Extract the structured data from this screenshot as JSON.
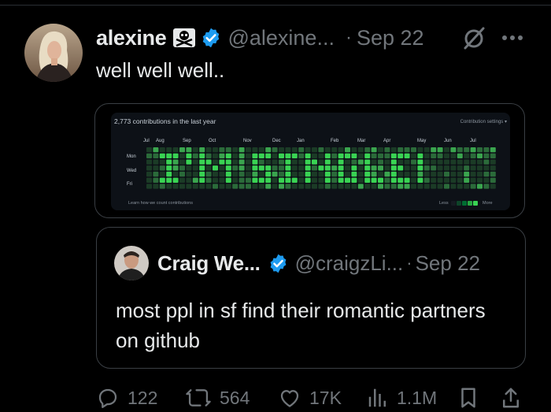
{
  "author": {
    "name": "alexine",
    "handle": "@alexine...",
    "date": "Sep 22"
  },
  "tweet": {
    "text": "well well well.."
  },
  "github_card": {
    "title": "2,773 contributions in the last year",
    "settings": "Contribution settings ▾",
    "months": [
      "Jul",
      "Aug",
      "Sep",
      "Oct",
      "Nov",
      "Dec",
      "Jan",
      "Feb",
      "Mar",
      "Apr",
      "May",
      "Jun",
      "Jul"
    ],
    "days": [
      "Mon",
      "Wed",
      "Fri"
    ],
    "footer": "Learn how we count contributions",
    "legend_less": "Less",
    "legend_more": "More",
    "message": "I'M SINGLE!",
    "colors": {
      "empty": "#1b3b26",
      "light": "#2b6b3a",
      "mid": "#3aa54e",
      "bright": "#39d353"
    }
  },
  "quote": {
    "name": "Craig We...",
    "handle": "@craigzLi...",
    "date": "Sep 22",
    "text": "most ppl in sf find their romantic partners on github"
  },
  "actions": {
    "replies": "122",
    "retweets": "564",
    "likes": "17K",
    "views": "1.1M"
  },
  "colors": {
    "background": "#000000",
    "text": "#e7e9ea",
    "muted": "#71767b",
    "verified": "#1d9bf0",
    "border": "#3a3f44"
  }
}
